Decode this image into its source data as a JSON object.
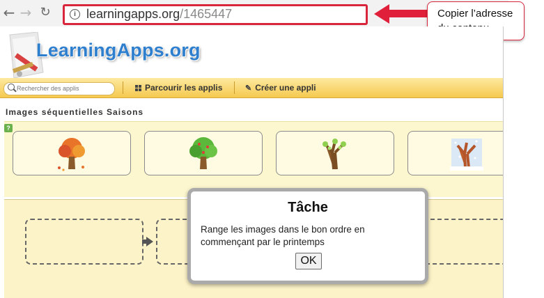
{
  "browser": {
    "url_host": "learningapps.org",
    "url_path": "/1465447"
  },
  "callout": {
    "line1": "Copier l’adresse",
    "line2": "du contenu",
    "color": "#e0203a"
  },
  "site": {
    "logo_text": "LearningApps.org",
    "search_placeholder": "Rechercher des applis",
    "nav_browse": "Parcourir les applis",
    "nav_create": "Créer une appli"
  },
  "app": {
    "title": "Images séquentielles Saisons",
    "cards": [
      {
        "icon": "autumn-tree-icon"
      },
      {
        "icon": "summer-tree-icon"
      },
      {
        "icon": "spring-tree-icon"
      },
      {
        "icon": "winter-tree-icon"
      }
    ]
  },
  "dialog": {
    "title": "Tâche",
    "line1": "Range les images dans le bon ordre en",
    "line2": "commençant par le printemps",
    "ok_label": "OK"
  },
  "colors": {
    "accent_red": "#d9263d",
    "toolbar_yellow": "#f5c94f",
    "logo_blue": "#2f7fcf"
  }
}
